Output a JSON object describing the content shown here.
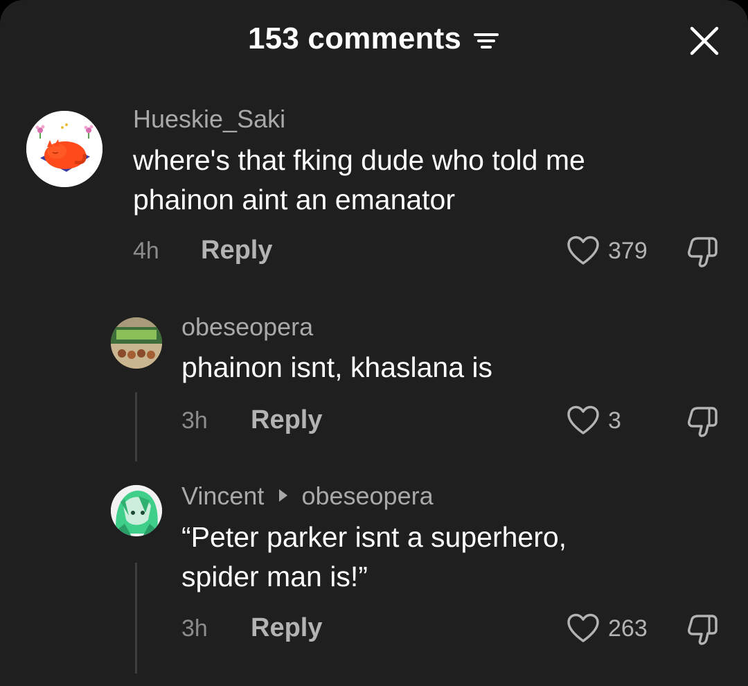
{
  "header": {
    "title": "153 comments",
    "sort_icon": "sort-filter-icon",
    "close_icon": "close-icon"
  },
  "comments": [
    {
      "username": "Hueskie_Saki",
      "text_lines": [
        "where's that fking dude who told me",
        "phainon aint an emanator"
      ],
      "time": "4h",
      "reply_label": "Reply",
      "likes": "379"
    },
    {
      "username": "obeseopera",
      "text_lines": [
        "phainon isnt, khaslana is"
      ],
      "time": "3h",
      "reply_label": "Reply",
      "likes": "3"
    },
    {
      "username": "Vincent",
      "reply_to": "obeseopera",
      "text_lines": [
        "“Peter parker isnt a superhero,",
        "spider man is!”"
      ],
      "time": "3h",
      "reply_label": "Reply",
      "likes": "263"
    }
  ],
  "colors": {
    "background": "#1f1f1f",
    "primary_text": "#ffffff",
    "secondary_text": "#a9a9a9",
    "icon_gray": "#b3b3b3"
  }
}
